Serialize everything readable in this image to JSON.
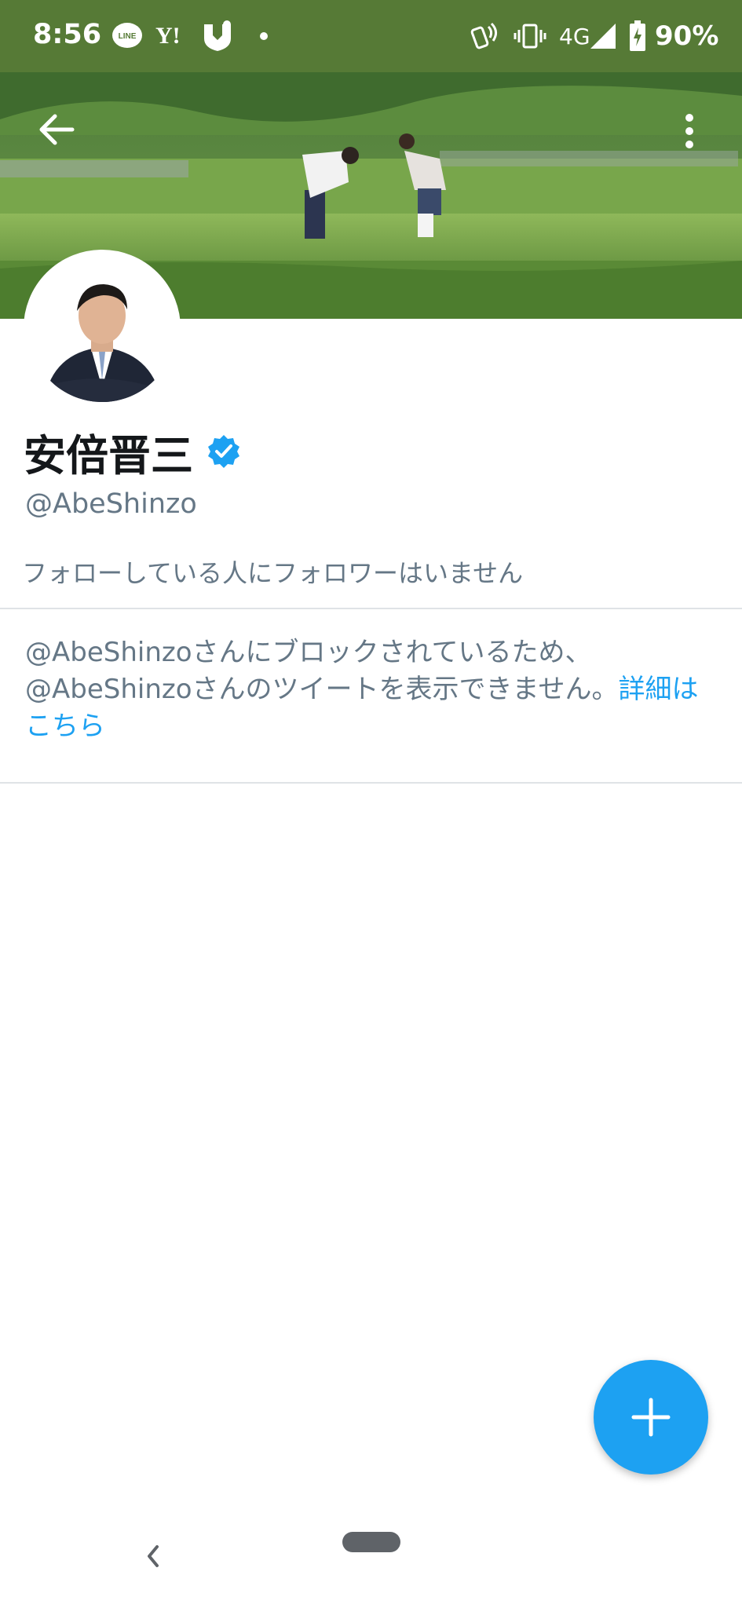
{
  "status_bar": {
    "time": "8:56",
    "network": "4G",
    "battery": "90%",
    "bg_color": "#567a36",
    "icons": [
      "line-icon",
      "yahoo-icon",
      "shield-app-icon",
      "dot-icon",
      "nfc-icon",
      "vibrate-icon",
      "signal-icon",
      "battery-icon"
    ],
    "line_label": "LINE",
    "yahoo_label": "Y!"
  },
  "profile": {
    "name": "安倍晋三",
    "handle": "@AbeShinzo",
    "verified": true,
    "follow_note": "フォローしている人にフォロワーはいません"
  },
  "block_notice": {
    "message": "@AbeShinzoさんにブロックされているため、@AbeShinzoさんのツイートを表示できません。",
    "link_text": "詳細はこちら"
  },
  "colors": {
    "accent": "#1da1f2",
    "text_primary": "#14171a",
    "text_secondary": "#657786"
  },
  "icons": {
    "back": "arrow-left-icon",
    "more": "more-vertical-icon",
    "fab": "plus-icon"
  }
}
